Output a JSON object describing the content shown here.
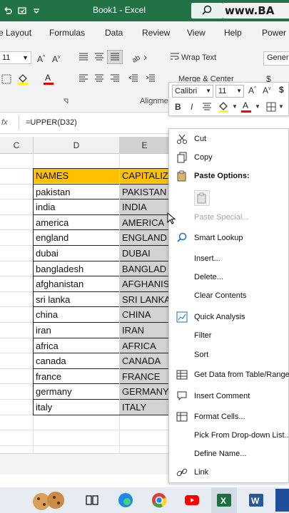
{
  "titlebar": {
    "title": "Book1 - Excel",
    "watermark": "www.BA",
    "quick_access": [
      "undo-icon",
      "redo-icon",
      "customize-icon"
    ],
    "accent": "#217346"
  },
  "ribbon_tabs": [
    "e Layout",
    "Formulas",
    "Data",
    "Review",
    "View",
    "Help",
    "Power"
  ],
  "ribbon": {
    "font_size": "11",
    "wrap_text": "Wrap Text",
    "merge_center": "Merge & Center",
    "number_format": "Genera",
    "alignment_label": "Alignme"
  },
  "formula_bar": {
    "fx": "fx",
    "formula": "=UPPER(D32)"
  },
  "columns": [
    "C",
    "D",
    "E"
  ],
  "table": {
    "headers": [
      "NAMES",
      "CAPITALIZ"
    ],
    "header_color": "#ffc000",
    "rows": [
      [
        "pakistan",
        "PAKISTAN"
      ],
      [
        "india",
        "INDIA"
      ],
      [
        "america",
        "AMERICA"
      ],
      [
        "england",
        "ENGLAND"
      ],
      [
        "dubai",
        "DUBAI"
      ],
      [
        "bangladesh",
        "BANGLAD"
      ],
      [
        "afghanistan",
        "AFGHANIS"
      ],
      [
        "sri lanka",
        "SRI LANKA"
      ],
      [
        "china",
        "CHINA"
      ],
      [
        "iran",
        "IRAN"
      ],
      [
        "africa",
        "AFRICA"
      ],
      [
        "canada",
        "CANADA"
      ],
      [
        "france",
        "FRANCE"
      ],
      [
        "germany",
        "GERMANY"
      ],
      [
        "italy",
        "ITALY"
      ]
    ]
  },
  "mini_toolbar": {
    "font": "Calibri",
    "size": "11",
    "bold": "B",
    "italic": "I",
    "font_color": "#ff0000",
    "fill_color": "#ffff00"
  },
  "context_menu": {
    "items": [
      {
        "label": "Cut",
        "icon": "scissors-icon"
      },
      {
        "label": "Copy",
        "icon": "copy-icon"
      },
      {
        "label": "Paste Options:",
        "icon": "paste-icon"
      },
      {
        "label": "Paste Special...",
        "icon": ""
      },
      {
        "label": "Smart Lookup",
        "icon": "search-icon"
      },
      {
        "label": "Insert...",
        "icon": ""
      },
      {
        "label": "Delete...",
        "icon": ""
      },
      {
        "label": "Clear Contents",
        "icon": ""
      },
      {
        "label": "Quick Analysis",
        "icon": "quick-analysis-icon"
      },
      {
        "label": "Filter",
        "icon": ""
      },
      {
        "label": "Sort",
        "icon": ""
      },
      {
        "label": "Get Data from Table/Range...",
        "icon": "table-icon"
      },
      {
        "label": "Insert Comment",
        "icon": "comment-icon"
      },
      {
        "label": "Format Cells...",
        "icon": "format-cells-icon"
      },
      {
        "label": "Pick From Drop-down List...",
        "icon": ""
      },
      {
        "label": "Define Name...",
        "icon": ""
      },
      {
        "label": "Link",
        "icon": "link-icon"
      }
    ]
  },
  "taskbar": {
    "icons": [
      "cookie-icon",
      "task-view-icon",
      "edge-icon",
      "chrome-icon",
      "youtube-icon",
      "excel-icon",
      "word-icon"
    ]
  }
}
